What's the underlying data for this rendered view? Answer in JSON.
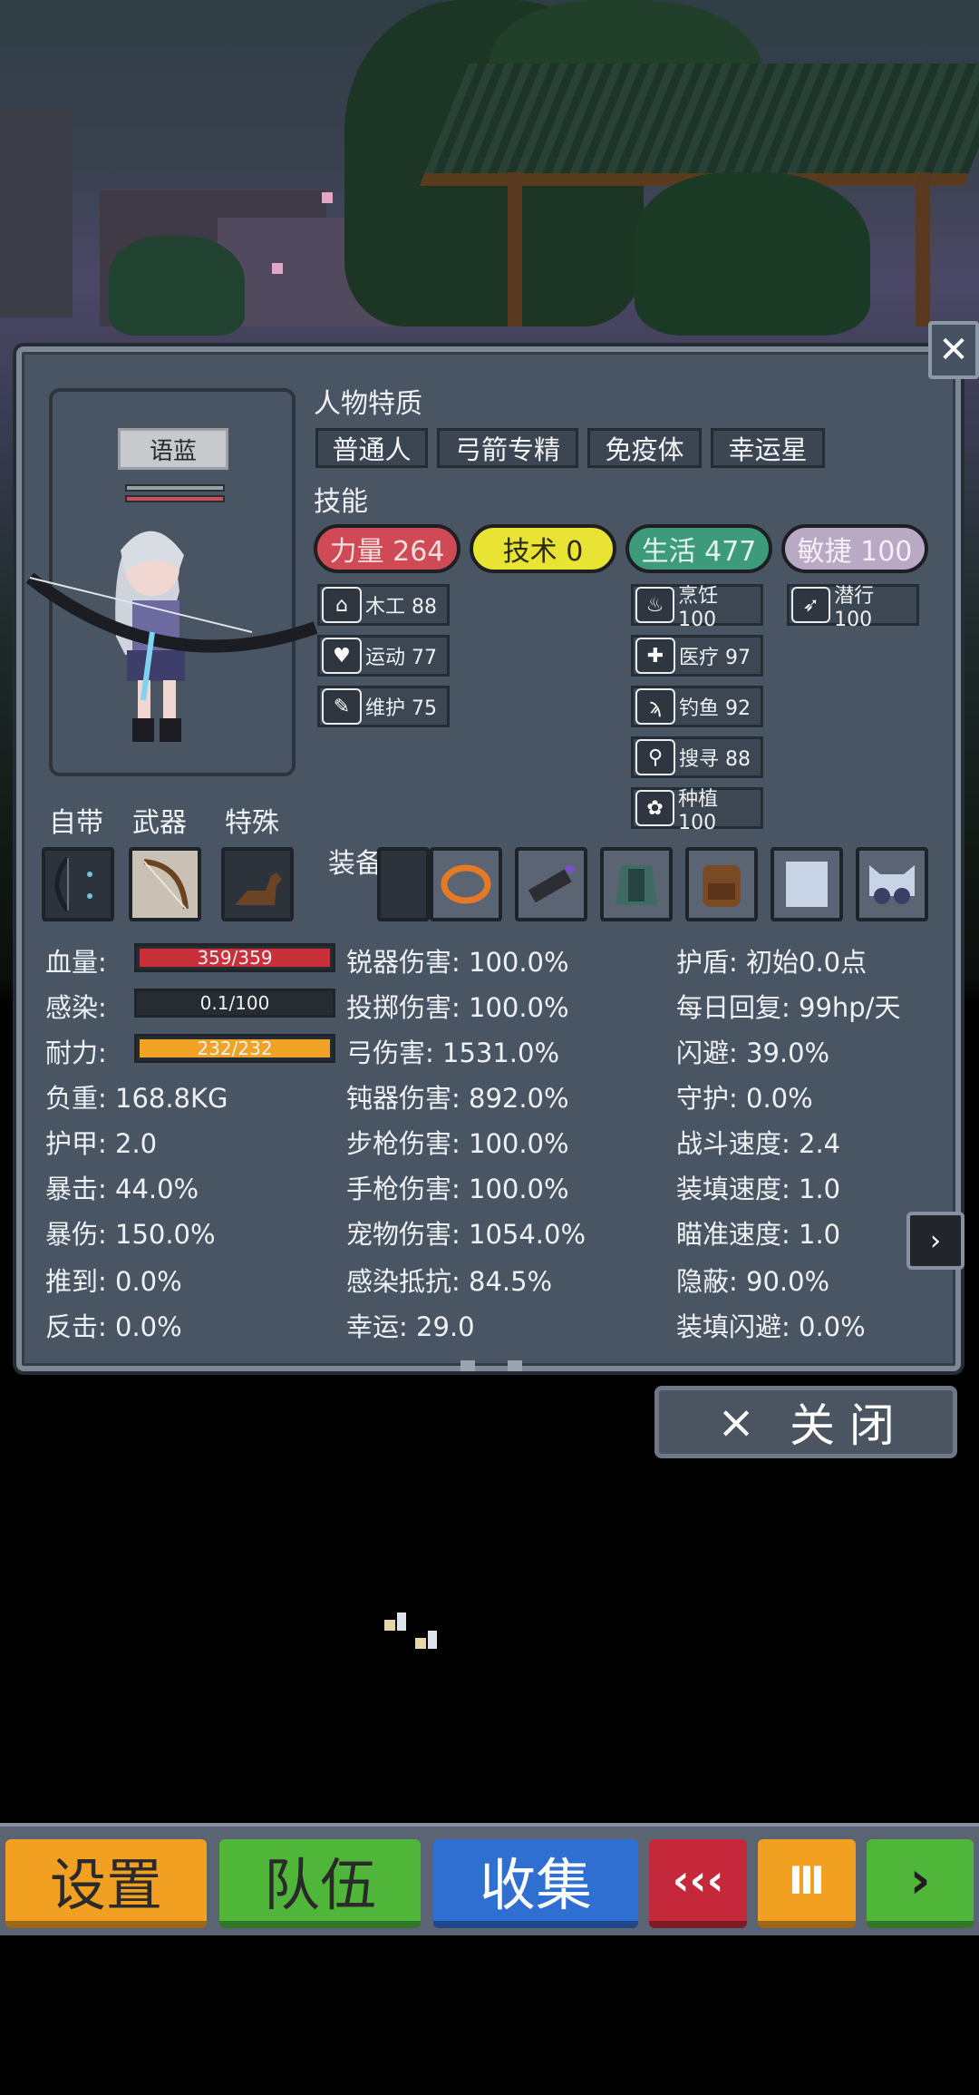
{
  "character": {
    "name": "语蓝"
  },
  "traits": {
    "title": "人物特质",
    "items": [
      "普通人",
      "弓箭专精",
      "免疫体",
      "幸运星"
    ]
  },
  "skills": {
    "title": "技能",
    "groups": [
      {
        "label": "力量 264",
        "color": "#cf4a55",
        "text_color": "#f3dede",
        "subs": [
          {
            "label": "木工 88",
            "icon": "house-icon"
          },
          {
            "label": "运动 77",
            "icon": "heart-icon"
          },
          {
            "label": "维护 75",
            "icon": "wrench-icon"
          }
        ]
      },
      {
        "label": "技术 0",
        "color": "#e9e334",
        "text_color": "#2c2a10",
        "subs": []
      },
      {
        "label": "生活 477",
        "color": "#3d9a7a",
        "text_color": "#e3f4ec",
        "subs": [
          {
            "label": "烹饪 100",
            "icon": "cooking-pot-icon"
          },
          {
            "label": "医疗 97",
            "icon": "medkit-icon"
          },
          {
            "label": "钓鱼 92",
            "icon": "fishing-icon"
          },
          {
            "label": "搜寻 88",
            "icon": "magnifier-icon"
          },
          {
            "label": "种植 100",
            "icon": "plant-icon"
          }
        ]
      },
      {
        "label": "敏捷 100",
        "color": "#b9a9c4",
        "text_color": "#f4eff6",
        "subs": [
          {
            "label": "潜行 100",
            "icon": "sneak-icon"
          }
        ]
      }
    ]
  },
  "loadout": {
    "labels": [
      "自带",
      "武器",
      "特殊"
    ],
    "equip_label": "装备"
  },
  "bars": [
    {
      "label": "血量:",
      "value": "359/359",
      "fraction": 1.0,
      "color": "#c9303c"
    },
    {
      "label": "感染:",
      "value": "0.1/100",
      "fraction": 0.001,
      "color": "#7d8590"
    },
    {
      "label": "耐力:",
      "value": "232/232",
      "fraction": 1.0,
      "color": "#f0a325"
    }
  ],
  "stats_col1": [
    "负重: 168.8KG",
    "护甲: 2.0",
    "暴击: 44.0%",
    "暴伤: 150.0%",
    "推到: 0.0%",
    "反击: 0.0%"
  ],
  "stats_col2": [
    "锐器伤害: 100.0%",
    "投掷伤害: 100.0%",
    "弓伤害: 1531.0%",
    "钝器伤害: 892.0%",
    "步枪伤害: 100.0%",
    "手枪伤害: 100.0%",
    "宠物伤害: 1054.0%",
    "感染抵抗: 84.5%",
    "幸运: 29.0"
  ],
  "stats_col3": [
    "护盾: 初始0.0点",
    "每日回复: 99hp/天",
    "闪避: 39.0%",
    "守护: 0.0%",
    "战斗速度: 2.4",
    "装填速度: 1.0",
    "瞄准速度: 1.0",
    "隐蔽: 90.0%",
    "装填闪避: 0.0%"
  ],
  "close_button": {
    "icon": "×",
    "label": "关 闭"
  },
  "bottom_bar": {
    "settings": "设置",
    "team": "队伍",
    "collect": "收集",
    "rewind": "‹‹‹",
    "pause": "Ⅲ",
    "play": "›"
  },
  "colors": {
    "settings": "#f2a022",
    "team": "#4fb63a",
    "collect": "#2f6fd1",
    "rewind": "#c5283a",
    "pause": "#f2a022",
    "play": "#4fb63a"
  }
}
